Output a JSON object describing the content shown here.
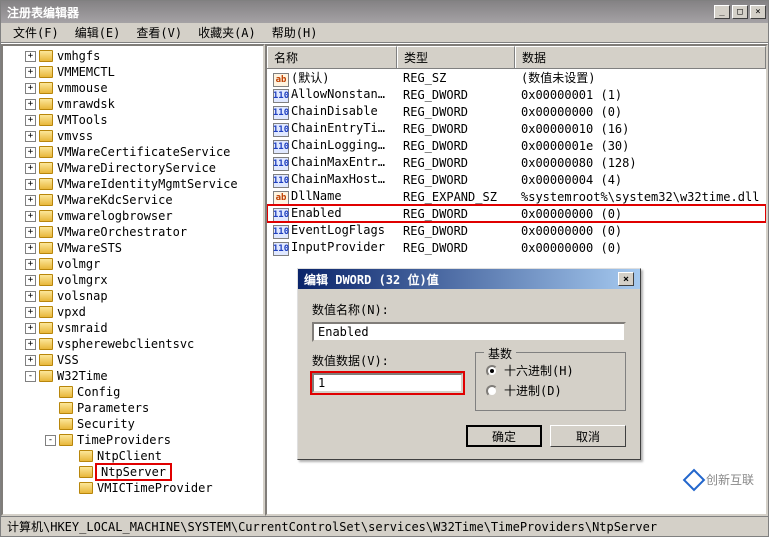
{
  "window": {
    "title": "注册表编辑器"
  },
  "menu": {
    "file": "文件(F)",
    "edit": "编辑(E)",
    "view": "查看(V)",
    "favorites": "收藏夹(A)",
    "help": "帮助(H)"
  },
  "tree": {
    "items": [
      {
        "label": "vmhgfs",
        "indent": 1,
        "exp": "+"
      },
      {
        "label": "VMMEMCTL",
        "indent": 1,
        "exp": "+"
      },
      {
        "label": "vmmouse",
        "indent": 1,
        "exp": "+"
      },
      {
        "label": "vmrawdsk",
        "indent": 1,
        "exp": "+"
      },
      {
        "label": "VMTools",
        "indent": 1,
        "exp": "+"
      },
      {
        "label": "vmvss",
        "indent": 1,
        "exp": "+"
      },
      {
        "label": "VMWareCertificateService",
        "indent": 1,
        "exp": "+"
      },
      {
        "label": "VMwareDirectoryService",
        "indent": 1,
        "exp": "+"
      },
      {
        "label": "VMwareIdentityMgmtService",
        "indent": 1,
        "exp": "+"
      },
      {
        "label": "VMwareKdcService",
        "indent": 1,
        "exp": "+"
      },
      {
        "label": "vmwarelogbrowser",
        "indent": 1,
        "exp": "+"
      },
      {
        "label": "VMwareOrchestrator",
        "indent": 1,
        "exp": "+"
      },
      {
        "label": "VMwareSTS",
        "indent": 1,
        "exp": "+"
      },
      {
        "label": "volmgr",
        "indent": 1,
        "exp": "+"
      },
      {
        "label": "volmgrx",
        "indent": 1,
        "exp": "+"
      },
      {
        "label": "volsnap",
        "indent": 1,
        "exp": "+"
      },
      {
        "label": "vpxd",
        "indent": 1,
        "exp": "+"
      },
      {
        "label": "vsmraid",
        "indent": 1,
        "exp": "+"
      },
      {
        "label": "vspherewebclientsvc",
        "indent": 1,
        "exp": "+"
      },
      {
        "label": "VSS",
        "indent": 1,
        "exp": "+"
      },
      {
        "label": "W32Time",
        "indent": 1,
        "exp": "-",
        "open": true
      },
      {
        "label": "Config",
        "indent": 2,
        "exp": ""
      },
      {
        "label": "Parameters",
        "indent": 2,
        "exp": ""
      },
      {
        "label": "Security",
        "indent": 2,
        "exp": ""
      },
      {
        "label": "TimeProviders",
        "indent": 2,
        "exp": "-",
        "open": true
      },
      {
        "label": "NtpClient",
        "indent": 3,
        "exp": ""
      },
      {
        "label": "NtpServer",
        "indent": 3,
        "exp": "",
        "highlight": true,
        "selected": true
      },
      {
        "label": "VMICTimeProvider",
        "indent": 3,
        "exp": ""
      }
    ]
  },
  "list": {
    "headers": {
      "name": "名称",
      "type": "类型",
      "data": "数据"
    },
    "rows": [
      {
        "icon": "str",
        "name": "(默认)",
        "type": "REG_SZ",
        "data": "(数值未设置)"
      },
      {
        "icon": "bin",
        "name": "AllowNonstandar...",
        "type": "REG_DWORD",
        "data": "0x00000001 (1)"
      },
      {
        "icon": "bin",
        "name": "ChainDisable",
        "type": "REG_DWORD",
        "data": "0x00000000 (0)"
      },
      {
        "icon": "bin",
        "name": "ChainEntryTimeout",
        "type": "REG_DWORD",
        "data": "0x00000010 (16)"
      },
      {
        "icon": "bin",
        "name": "ChainLoggingRate",
        "type": "REG_DWORD",
        "data": "0x0000001e (30)"
      },
      {
        "icon": "bin",
        "name": "ChainMaxEntries",
        "type": "REG_DWORD",
        "data": "0x00000080 (128)"
      },
      {
        "icon": "bin",
        "name": "ChainMaxHostEnt...",
        "type": "REG_DWORD",
        "data": "0x00000004 (4)"
      },
      {
        "icon": "str",
        "name": "DllName",
        "type": "REG_EXPAND_SZ",
        "data": "%systemroot%\\system32\\w32time.dll"
      },
      {
        "icon": "bin",
        "name": "Enabled",
        "type": "REG_DWORD",
        "data": "0x00000000 (0)",
        "highlight": true
      },
      {
        "icon": "bin",
        "name": "EventLogFlags",
        "type": "REG_DWORD",
        "data": "0x00000000 (0)"
      },
      {
        "icon": "bin",
        "name": "InputProvider",
        "type": "REG_DWORD",
        "data": "0x00000000 (0)"
      }
    ]
  },
  "dialog": {
    "title": "编辑 DWORD (32 位)值",
    "name_label": "数值名称(N):",
    "name_value": "Enabled",
    "data_label": "数值数据(V):",
    "data_value": "1",
    "base_label": "基数",
    "hex_label": "十六进制(H)",
    "dec_label": "十进制(D)",
    "ok": "确定",
    "cancel": "取消"
  },
  "statusbar": {
    "path": "计算机\\HKEY_LOCAL_MACHINE\\SYSTEM\\CurrentControlSet\\services\\W32Time\\TimeProviders\\NtpServer"
  },
  "watermark": {
    "text": "创新互联"
  }
}
